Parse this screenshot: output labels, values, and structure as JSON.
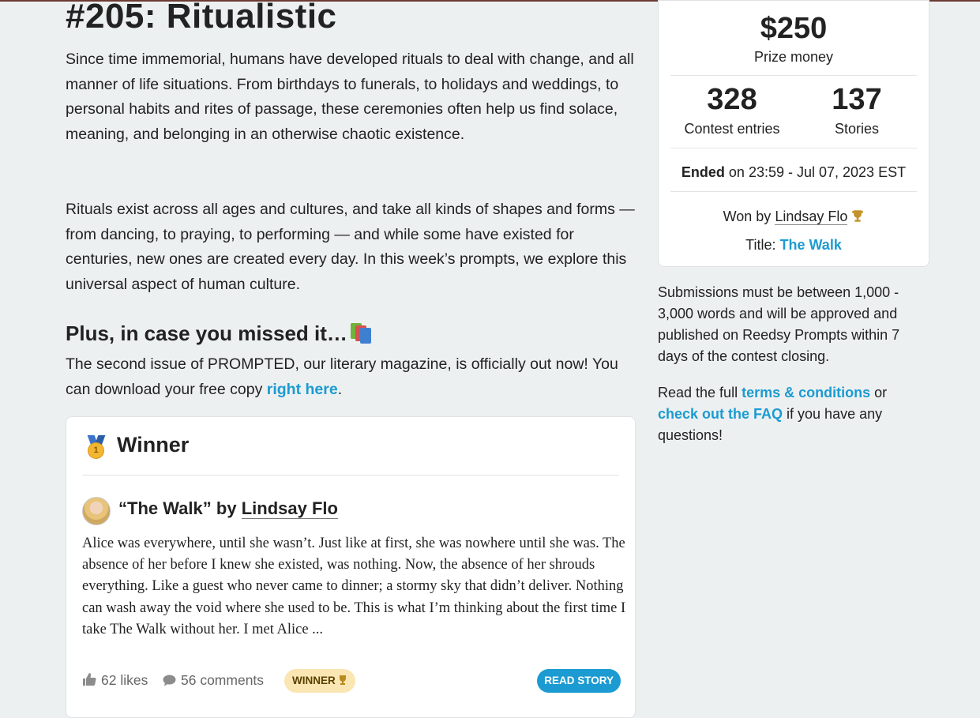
{
  "header": {
    "title": "#205: Ritualistic"
  },
  "intro": {
    "paragraph1": "Since time immemorial, humans have developed rituals to deal with change, and all manner of life situations. From birthdays to funerals, to holidays and weddings, to personal habits and rites of passage, these ceremonies often help us find solace, meaning, and belonging in an otherwise chaotic existence.",
    "paragraph2": "Rituals exist across all ages and cultures, and take all kinds of shapes and forms — from dancing, to praying, to performing — and while some have existed for centuries, new ones are created every day. In this week’s prompts, we explore this universal aspect of human culture."
  },
  "plus": {
    "heading": "Plus, in case you missed it…",
    "icon": "books-icon",
    "text_before": "The second issue of PROMPTED, our literary magazine, is officially out now! You can download your free copy ",
    "link_label": "right here",
    "text_after": "."
  },
  "winner_card": {
    "title": "Winner",
    "medal_number": "1",
    "story_title": "“The Walk”",
    "by": "by",
    "author": "Lindsay Flo",
    "excerpt": "Alice was everywhere, until she wasn’t. Just like at first, she was nowhere until she was. The absence of her before I knew she existed, was nothing. Now, the absence of her shrouds everything. Like a guest who never came to dinner; a stormy sky that didn’t deliver. Nothing can wash away the void where she used to be. This is what I’m thinking about the first time I take The Walk without her. I met Alice ...",
    "likes": "62 likes",
    "comments": "56 comments",
    "badge": "WINNER",
    "read_button": "READ STORY"
  },
  "stats": {
    "prize_amount": "$250",
    "prize_label": "Prize money",
    "entries_count": "328",
    "entries_label": "Contest entries",
    "stories_count": "137",
    "stories_label": "Stories",
    "ended_label": "Ended",
    "ended_text": " on 23:59 - Jul 07, 2023 EST",
    "won_by_label": "Won by ",
    "won_by_author": "Lindsay Flo",
    "title_label": "Title: ",
    "title_link": "The Walk"
  },
  "sidebar": {
    "rules_text": "Submissions must be between 1,000 - 3,000 words and will be approved and published on Reedsy Prompts within 7 days of the contest closing.",
    "terms_prefix": "Read the full ",
    "terms_link": "terms & conditions",
    "terms_mid": " or ",
    "faq_link": "check out the FAQ",
    "terms_suffix": " if you have any questions!"
  },
  "colors": {
    "accent": "#1b9bd1",
    "background": "#edf0f1",
    "badge_bg": "#fae6b3"
  }
}
